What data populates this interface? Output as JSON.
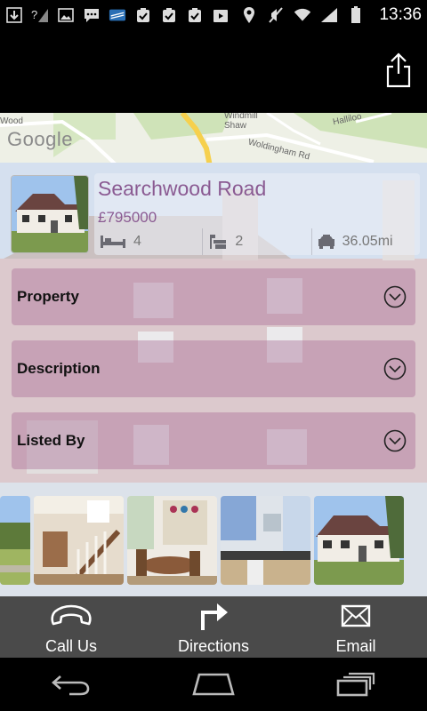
{
  "status_bar": {
    "time": "13:36",
    "left_icons": [
      "download-icon",
      "no-signal-icon",
      "image-icon",
      "chat-icon",
      "card-icon",
      "clipboard-check-icon",
      "clipboard-check-icon",
      "clipboard-check-icon",
      "play-store-icon"
    ],
    "right_icons": [
      "location-icon",
      "mute-icon",
      "wifi-icon",
      "signal-icon",
      "battery-icon"
    ]
  },
  "action_bar": {
    "share_icon": "share-icon"
  },
  "map": {
    "logo": "Google",
    "labels": [
      "Wood",
      "Windmill Shaw",
      "Woldingham Rd",
      "Halliloo",
      "Hallilo"
    ],
    "colors": {
      "land": "#eef0e6",
      "green": "#cfe3b8",
      "road_major": "#f6d04d"
    }
  },
  "listing": {
    "title": "Searchwood Road",
    "price": "£795000",
    "bedrooms": "4",
    "bathrooms": "2",
    "distance": "36.05mi",
    "bed_icon": "bed-icon",
    "bath_icon": "bath-icon",
    "car_icon": "car-icon",
    "accent_color": "#8a5a92"
  },
  "sections": [
    {
      "label": "Property"
    },
    {
      "label": "Description"
    },
    {
      "label": "Listed By"
    }
  ],
  "gallery": {
    "images": [
      "house-garden-photo",
      "staircase-photo",
      "dining-room-photo",
      "kitchen-photo",
      "house-exterior-photo"
    ]
  },
  "bottom_bar": {
    "call": {
      "label": "Call Us",
      "icon": "phone-icon"
    },
    "directions": {
      "label": "Directions",
      "icon": "turn-arrow-icon"
    },
    "email": {
      "label": "Email",
      "icon": "envelope-icon"
    }
  },
  "nav_bar": {
    "back": "back-icon",
    "home": "home-icon",
    "recents": "recents-icon"
  }
}
